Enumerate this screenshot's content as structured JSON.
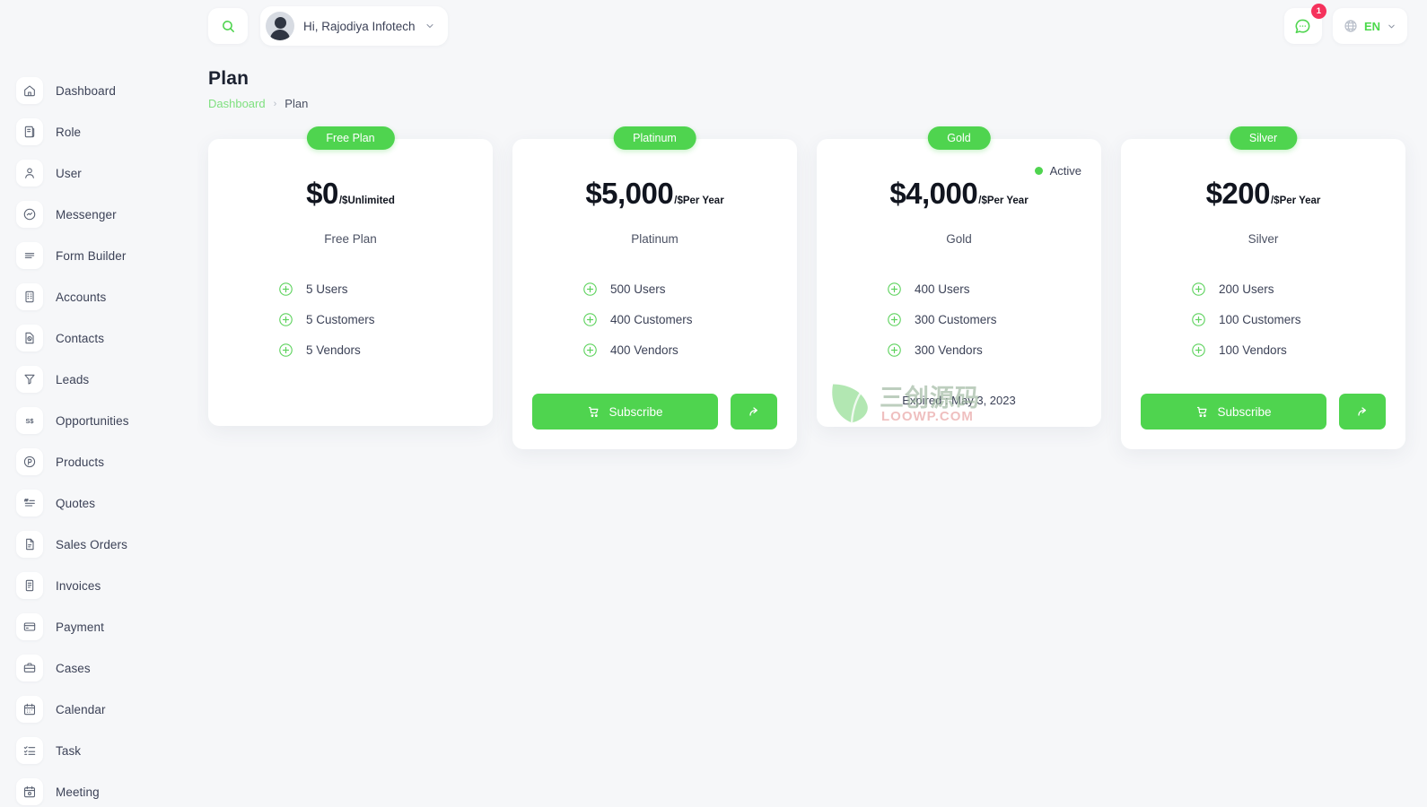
{
  "topbar": {
    "search_icon": "search-icon",
    "user_greeting": "Hi, Rajodiya Infotech",
    "chevron": "⌄",
    "message_icon": "chat-icon",
    "message_count": "1",
    "globe_icon": "globe-icon",
    "language": "EN"
  },
  "page": {
    "title": "Plan",
    "breadcrumb": {
      "parent": "Dashboard",
      "separator": "›",
      "current": "Plan"
    }
  },
  "sidebar": {
    "items": [
      {
        "label": "Dashboard",
        "icon": "home-icon"
      },
      {
        "label": "Role",
        "icon": "scroll-icon"
      },
      {
        "label": "User",
        "icon": "user-icon"
      },
      {
        "label": "Messenger",
        "icon": "message-icon"
      },
      {
        "label": "Form Builder",
        "icon": "lines-icon"
      },
      {
        "label": "Accounts",
        "icon": "building-icon"
      },
      {
        "label": "Contacts",
        "icon": "contact-card-icon"
      },
      {
        "label": "Leads",
        "icon": "funnel-icon"
      },
      {
        "label": "Opportunities",
        "icon": "dollar-icon"
      },
      {
        "label": "Products",
        "icon": "p-circle-icon"
      },
      {
        "label": "Quotes",
        "icon": "quote-icon"
      },
      {
        "label": "Sales Orders",
        "icon": "file-icon"
      },
      {
        "label": "Invoices",
        "icon": "invoice-icon"
      },
      {
        "label": "Payment",
        "icon": "card-icon"
      },
      {
        "label": "Cases",
        "icon": "briefcase-icon"
      },
      {
        "label": "Calendar",
        "icon": "calendar-icon"
      },
      {
        "label": "Task",
        "icon": "checklist-icon"
      },
      {
        "label": "Meeting",
        "icon": "meeting-icon"
      }
    ]
  },
  "plans": [
    {
      "badge": "Free Plan",
      "price": "$0",
      "price_unit": "/$Unlimited",
      "name": "Free Plan",
      "features": [
        {
          "text": "5 Users",
          "icon": "plus-circle-icon"
        },
        {
          "text": "5 Customers",
          "icon": "plus-circle-icon"
        },
        {
          "text": "5 Vendors",
          "icon": "plus-circle-icon"
        }
      ],
      "has_subscribe": false,
      "has_share": false,
      "status": null,
      "expired": null
    },
    {
      "badge": "Platinum",
      "price": "$5,000",
      "price_unit": "/$Per Year",
      "name": "Platinum",
      "features": [
        {
          "text": "500 Users",
          "icon": "plus-circle-icon"
        },
        {
          "text": "400 Customers",
          "icon": "plus-circle-icon"
        },
        {
          "text": "400 Vendors",
          "icon": "plus-circle-icon"
        }
      ],
      "has_subscribe": true,
      "subscribe_label": "Subscribe",
      "has_share": true,
      "status": null,
      "expired": null
    },
    {
      "badge": "Gold",
      "price": "$4,000",
      "price_unit": "/$Per Year",
      "name": "Gold",
      "features": [
        {
          "text": "400 Users",
          "icon": "plus-circle-icon"
        },
        {
          "text": "300 Customers",
          "icon": "plus-circle-icon"
        },
        {
          "text": "300 Vendors",
          "icon": "plus-circle-icon"
        }
      ],
      "has_subscribe": false,
      "has_share": false,
      "status": "Active",
      "expired": "Expired : May 3, 2023"
    },
    {
      "badge": "Silver",
      "price": "$200",
      "price_unit": "/$Per Year",
      "name": "Silver",
      "features": [
        {
          "text": "200 Users",
          "icon": "plus-circle-icon"
        },
        {
          "text": "100 Customers",
          "icon": "plus-circle-icon"
        },
        {
          "text": "100 Vendors",
          "icon": "plus-circle-icon"
        }
      ],
      "has_subscribe": true,
      "subscribe_label": "Subscribe",
      "has_share": true,
      "status": null,
      "expired": null
    }
  ],
  "watermark": {
    "cn": "三创源码",
    "domain": "LOOWP.COM"
  },
  "colors": {
    "accent_green": "#4fd44f",
    "badge_red": "#f5325c",
    "page_bg": "#f6f7f9",
    "card_bg": "#ffffff",
    "text_dark": "#3c4257"
  }
}
